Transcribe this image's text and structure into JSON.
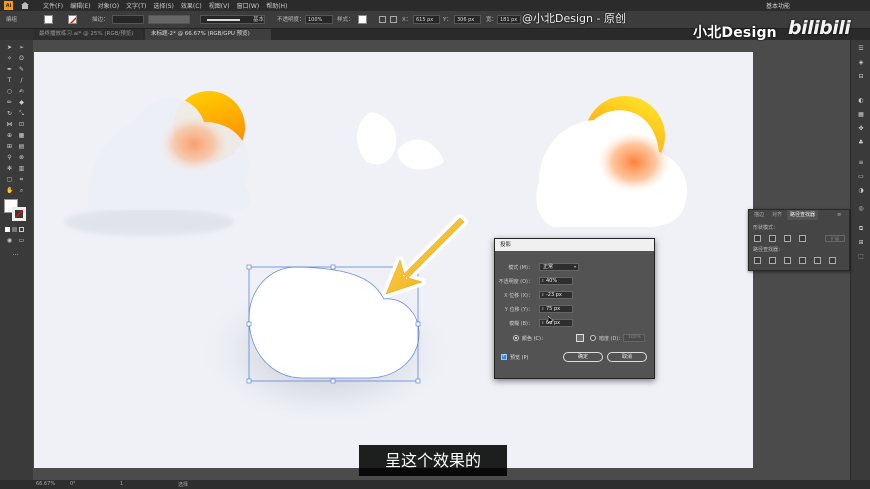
{
  "app": {
    "logo_text": "Ai",
    "menu": [
      "文件(F)",
      "编辑(E)",
      "对象(O)",
      "文字(T)",
      "选择(S)",
      "效果(C)",
      "视图(V)",
      "窗口(W)",
      "帮助(H)"
    ],
    "workspace": "基本功能"
  },
  "control_bar": {
    "selection_label": "编组",
    "stroke_label": "描边：",
    "stroke_style": "基本",
    "opacity_label": "不透明度：",
    "opacity_value": "100%",
    "style_label": "样式：",
    "x_label": "X：",
    "x_value": "615 px",
    "y_label": "Y：",
    "y_value": "306 px",
    "w_label": "宽：",
    "w_value": "181 px",
    "h_label": "高：",
    "h_value": "115 px"
  },
  "tabs": [
    {
      "label": "最终播放练习.ai* @ 25% (RGB/预览)",
      "active": false
    },
    {
      "label": "未标题-2* @ 66.67% (RGB/GPU 预览)",
      "active": true
    }
  ],
  "pathfinder": {
    "tabs": [
      "描边",
      "对齐",
      "路径查找器"
    ],
    "shape_modes_label": "形状模式：",
    "pathfinders_label": "路径查找器：",
    "expand_label": "扩展"
  },
  "dialog": {
    "title": "投影",
    "mode_label": "模式 (M)：",
    "mode_value": "正常",
    "opacity_label": "不透明度 (O)：",
    "opacity_value": "40%",
    "x_label": "X 位移 (X)：",
    "x_value": "-23 px",
    "y_label": "Y 位移 (Y)：",
    "y_value": "75 px",
    "blur_label": "模糊 (B)：",
    "blur_value": "60 px",
    "color_label": "颜色 (C)：",
    "darkness_label": "暗度 (D)：",
    "darkness_value": "100%",
    "preview_label": "预览 (P)",
    "ok_label": "确定",
    "cancel_label": "取消"
  },
  "status": {
    "zoom": "66.67%",
    "rotation": "0°",
    "page": "1",
    "tool": "选择"
  },
  "watermark": {
    "top": "@小北Design - 原创",
    "brand": "小北Design",
    "site": "bilibili"
  },
  "subtitle": "呈这个效果的",
  "colors": {
    "artboard": "#eff1f7",
    "sun_start": "#ffd400",
    "sun_end": "#ff7a1a",
    "arrow": "#f5b71c",
    "selection": "#4a78d8"
  }
}
